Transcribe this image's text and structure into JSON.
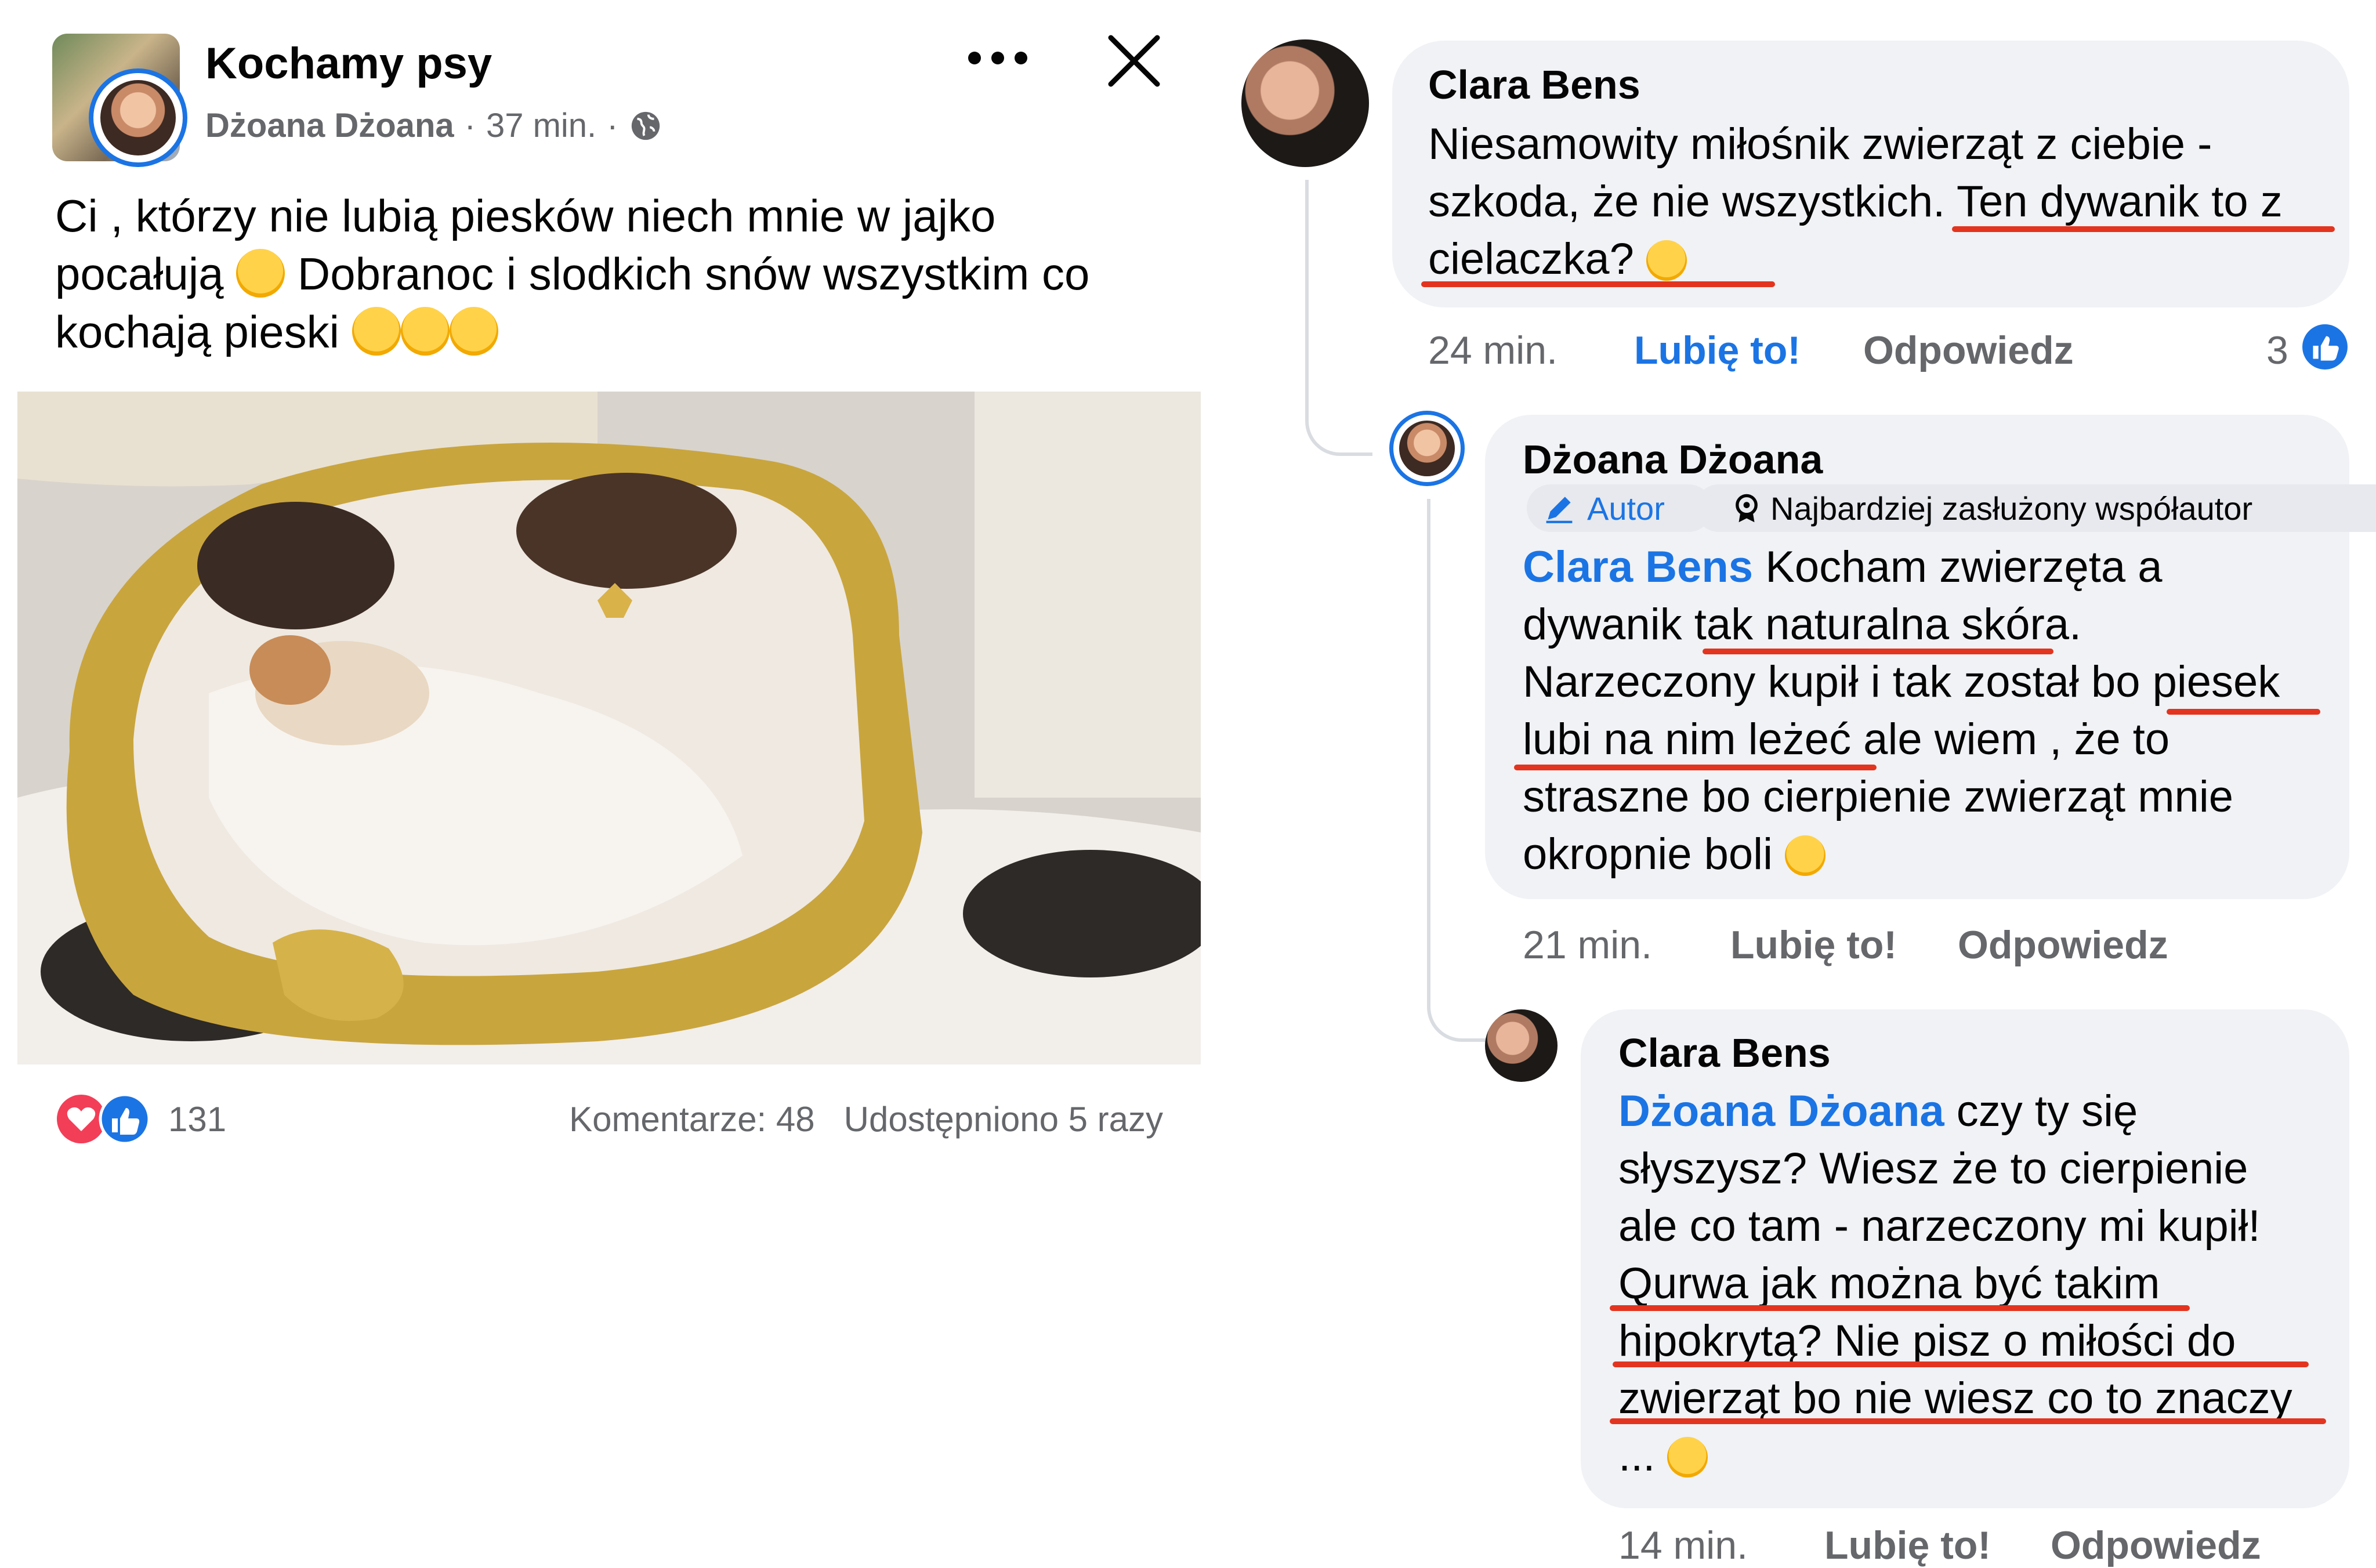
{
  "post": {
    "group_name": "Kochamy psy",
    "author": "Dżoana Dżoana",
    "time": "37 min.",
    "separator": "·",
    "text_lines": [
      "Ci , którzy nie lubią piesków niech mnie w jajko",
      "pocałują",
      "Dobranoc i slodkich snów wszystkim co",
      "kochają pieski"
    ],
    "reactions_count": "131",
    "comments_label": "Komentarze: 48",
    "shares_label": "Udostępniono 5 razy",
    "icons": [
      "globe-icon",
      "more-icon",
      "close-icon",
      "laughing-emoji",
      "heart-face-emoji",
      "love-reaction-icon",
      "like-reaction-icon"
    ]
  },
  "comments": [
    {
      "author": "Clara Bens",
      "lines": [
        "Niesamowity miłośnik zwierząt z ciebie -",
        "szkoda, że nie wszystkich. Ten dywanik to z",
        "cielaczka?"
      ],
      "time": "24 min.",
      "like": "Lubię to!",
      "reply": "Odpowiedz",
      "likes": "3"
    },
    {
      "author": "Dżoana Dżoana",
      "badge_author": "Autor",
      "badge_top": "Najbardziej zasłużony współautor",
      "mention": "Clara Bens",
      "lines": [
        "Kocham zwierzęta a",
        "dywanik tak naturalna skóra.",
        "Narzeczony kupił i tak został bo piesek",
        "lubi na nim leżeć ale wiem , że to",
        "straszne bo cierpienie zwierząt mnie",
        "okropnie  boli"
      ],
      "time": "21 min.",
      "like": "Lubię to!",
      "reply": "Odpowiedz"
    },
    {
      "author": "Clara Bens",
      "mention": "Dżoana Dżoana",
      "lines": [
        "czy ty się",
        "słyszysz? Wiesz że to cierpienie",
        "ale co tam - narzeczony mi kupił!",
        "Qurwa jak można być takim",
        "hipokrytą? Nie pisz o miłości do",
        "zwierząt bo nie wiesz co to znaczy",
        "..."
      ],
      "time": "14 min.",
      "like": "Lubię to!",
      "reply": "Odpowiedz"
    }
  ],
  "colors": {
    "accent": "#1b74e4",
    "underline": "#e3341f",
    "bubble": "#f0f2f5",
    "muted": "#65676b"
  }
}
